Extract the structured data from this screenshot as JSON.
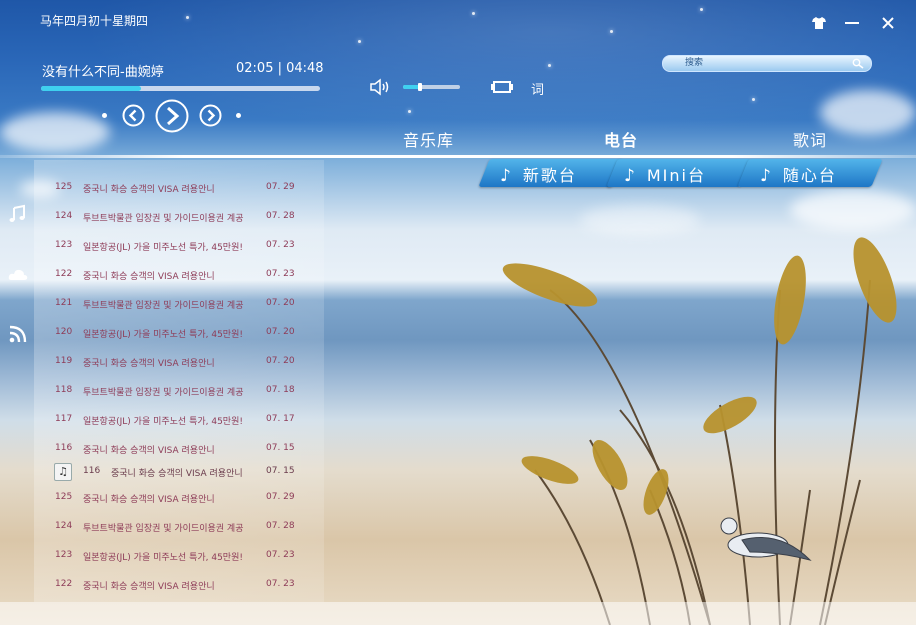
{
  "header": {
    "date_label": "马年四月初十星期四"
  },
  "window_controls": {
    "skin": "skin-icon",
    "minimize": "minimize-icon",
    "close": "close-icon"
  },
  "player": {
    "song": "没有什么不同-曲婉婷",
    "time": "02:05 | 04:48",
    "progress_fraction": 0.36,
    "volume_fraction": 0.3,
    "lyric_label": "词"
  },
  "search": {
    "placeholder": "搜索"
  },
  "nav": {
    "tabs": [
      {
        "label": "音乐库"
      },
      {
        "label": "电台"
      },
      {
        "label": "歌词"
      }
    ],
    "active": 1
  },
  "radio_tabs": [
    {
      "label": "新歌台"
    },
    {
      "label": "MIni台"
    },
    {
      "label": "随心台"
    }
  ],
  "sidebar": {
    "items": [
      {
        "icon": "music-note-icon"
      },
      {
        "icon": "cloud-icon"
      },
      {
        "icon": "rss-icon"
      }
    ]
  },
  "list": {
    "rows": [
      {
        "num": "125",
        "title": "중국니 화승 승객의 VISA 려용안니",
        "date": "07. 29"
      },
      {
        "num": "124",
        "title": "투브트박물관 입장권 및 가이드이용권 계공",
        "date": "07. 28"
      },
      {
        "num": "123",
        "title": "일본항공(JL) 가을 미주노선 특가, 45만원!",
        "date": "07. 23"
      },
      {
        "num": "122",
        "title": "중국니 화승 승객의 VISA 려용안니",
        "date": "07. 23"
      },
      {
        "num": "121",
        "title": "투브트박물관 입장권 및 가이드이용권 계공",
        "date": "07. 20"
      },
      {
        "num": "120",
        "title": "일본항공(JL) 가을 미주노선 특가, 45만원!",
        "date": "07. 20"
      },
      {
        "num": "119",
        "title": "중국니 화승 승객의 VISA 려용안니",
        "date": "07. 20"
      },
      {
        "num": "118",
        "title": "투브트박물관 입장권 및 가이드이용권 계공",
        "date": "07. 18"
      },
      {
        "num": "117",
        "title": "일본항공(JL) 가을 미주노선 특가, 45만원!",
        "date": "07. 17"
      },
      {
        "num": "116",
        "title": "중국니 화승 승객의 VISA 려용안니",
        "date": "07. 15"
      },
      {
        "num": "116",
        "title": "중국니 화승 승객의 VISA 려용안니",
        "date": "07. 15",
        "now_playing": true
      },
      {
        "num": "125",
        "title": "중국니 화승 승객의 VISA 려용안니",
        "date": "07. 29"
      },
      {
        "num": "124",
        "title": "투브트박물관 입장권 및 가이드이용권 계공",
        "date": "07. 28"
      },
      {
        "num": "123",
        "title": "일본항공(JL) 가을 미주노선 특가, 45만원!",
        "date": "07. 23"
      },
      {
        "num": "122",
        "title": "중국니 화승 승객의 VISA 려용안니",
        "date": "07. 23"
      }
    ],
    "now_playing_icon": "music-note-icon"
  }
}
